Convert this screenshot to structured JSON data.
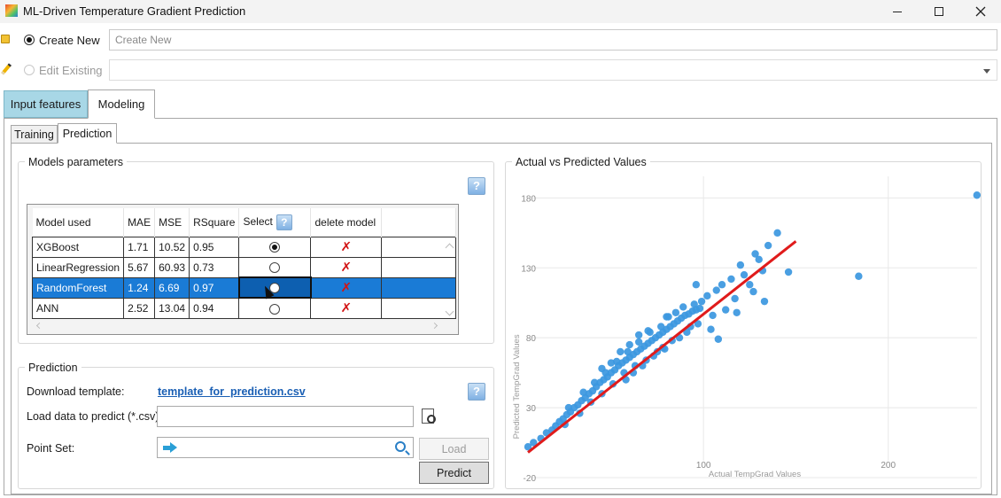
{
  "window": {
    "title": "ML-Driven Temperature Gradient Prediction"
  },
  "mode": {
    "create_label": "Create New",
    "create_placeholder": "Create New",
    "edit_label": "Edit Existing",
    "edit_value": ""
  },
  "tabs": {
    "input_features": "Input features",
    "modeling": "Modeling"
  },
  "subtabs": {
    "training": "Training",
    "prediction": "Prediction"
  },
  "models_group": {
    "title": "Models parameters",
    "help": "?",
    "columns": [
      "Model used",
      "MAE",
      "MSE",
      "RSquare",
      "Select",
      "delete model"
    ],
    "rows": [
      {
        "model": "XGBoost",
        "mae": "1.71",
        "mse": "10.52",
        "rsquare": "0.95",
        "selected": true,
        "highlight": false
      },
      {
        "model": "LinearRegression",
        "mae": "5.67",
        "mse": "60.93",
        "rsquare": "0.73",
        "selected": false,
        "highlight": false
      },
      {
        "model": "RandomForest",
        "mae": "1.24",
        "mse": "6.69",
        "rsquare": "0.97",
        "selected": false,
        "highlight": true
      },
      {
        "model": "ANN",
        "mae": "2.52",
        "mse": "13.04",
        "rsquare": "0.94",
        "selected": false,
        "highlight": false
      }
    ]
  },
  "prediction_group": {
    "title": "Prediction",
    "download_label": "Download template:",
    "download_link": "template_for_prediction.csv",
    "load_label": "Load data to predict (*.csv):",
    "load_value": "",
    "point_set_label": "Point Set:",
    "point_set_value": "",
    "load_button": "Load",
    "predict_button": "Predict",
    "help": "?"
  },
  "chart_group": {
    "title": "Actual vs Predicted Values"
  },
  "colors": {
    "accent": "#1a7bd6",
    "points": "#3b97e0",
    "fit_line": "#e01b1b",
    "tab_active": "#a8d7e6"
  },
  "chart_data": {
    "type": "scatter",
    "xlabel": "Actual TempGrad Values",
    "ylabel": "Predicted TempGrad Values",
    "xlim": [
      -7,
      250
    ],
    "ylim": [
      -27,
      198
    ],
    "xticks": [
      100,
      200
    ],
    "yticks": [
      -20,
      30,
      80,
      130,
      180
    ],
    "grid": true,
    "series": [
      {
        "points": [
          [
            5,
            2
          ],
          [
            8,
            5
          ],
          [
            12,
            8
          ],
          [
            15,
            12
          ],
          [
            18,
            14
          ],
          [
            20,
            17
          ],
          [
            22,
            20
          ],
          [
            24,
            22
          ],
          [
            26,
            25
          ],
          [
            28,
            27
          ],
          [
            30,
            30
          ],
          [
            32,
            32
          ],
          [
            34,
            35
          ],
          [
            36,
            37
          ],
          [
            38,
            40
          ],
          [
            40,
            42
          ],
          [
            42,
            45
          ],
          [
            44,
            48
          ],
          [
            46,
            50
          ],
          [
            48,
            52
          ],
          [
            50,
            55
          ],
          [
            52,
            57
          ],
          [
            54,
            60
          ],
          [
            56,
            62
          ],
          [
            58,
            64
          ],
          [
            60,
            66
          ],
          [
            62,
            68
          ],
          [
            64,
            70
          ],
          [
            66,
            72
          ],
          [
            68,
            74
          ],
          [
            70,
            76
          ],
          [
            72,
            78
          ],
          [
            74,
            80
          ],
          [
            76,
            82
          ],
          [
            78,
            84
          ],
          [
            80,
            86
          ],
          [
            82,
            88
          ],
          [
            84,
            90
          ],
          [
            86,
            92
          ],
          [
            88,
            94
          ],
          [
            90,
            96
          ],
          [
            92,
            97
          ],
          [
            94,
            99
          ],
          [
            96,
            100
          ],
          [
            98,
            101
          ],
          [
            25,
            18
          ],
          [
            27,
            30
          ],
          [
            33,
            26
          ],
          [
            35,
            41
          ],
          [
            39,
            34
          ],
          [
            41,
            48
          ],
          [
            45,
            40
          ],
          [
            47,
            55
          ],
          [
            51,
            47
          ],
          [
            53,
            63
          ],
          [
            57,
            55
          ],
          [
            59,
            70
          ],
          [
            63,
            60
          ],
          [
            65,
            77
          ],
          [
            69,
            64
          ],
          [
            71,
            84
          ],
          [
            75,
            70
          ],
          [
            77,
            88
          ],
          [
            79,
            72
          ],
          [
            81,
            95
          ],
          [
            83,
            78
          ],
          [
            85,
            98
          ],
          [
            87,
            80
          ],
          [
            89,
            102
          ],
          [
            91,
            84
          ],
          [
            93,
            88
          ],
          [
            95,
            104
          ],
          [
            97,
            90
          ],
          [
            99,
            106
          ],
          [
            60,
            75
          ],
          [
            55,
            70
          ],
          [
            50,
            62
          ],
          [
            45,
            58
          ],
          [
            70,
            85
          ],
          [
            65,
            82
          ],
          [
            58,
            50
          ],
          [
            62,
            55
          ],
          [
            67,
            60
          ],
          [
            73,
            67
          ],
          [
            78,
            73
          ],
          [
            102,
            110
          ],
          [
            105,
            96
          ],
          [
            107,
            114
          ],
          [
            110,
            118
          ],
          [
            112,
            100
          ],
          [
            115,
            122
          ],
          [
            117,
            108
          ],
          [
            120,
            132
          ],
          [
            122,
            125
          ],
          [
            125,
            118
          ],
          [
            128,
            140
          ],
          [
            130,
            136
          ],
          [
            132,
            128
          ],
          [
            135,
            146
          ],
          [
            140,
            155
          ],
          [
            146,
            127
          ],
          [
            184,
            124
          ],
          [
            248,
            182
          ],
          [
            96,
            118
          ],
          [
            104,
            86
          ],
          [
            108,
            79
          ],
          [
            118,
            98
          ],
          [
            127,
            113
          ],
          [
            133,
            106
          ],
          [
            80,
            95
          ]
        ]
      }
    ],
    "fit_line": [
      [
        5,
        -2
      ],
      [
        150,
        149
      ]
    ]
  }
}
